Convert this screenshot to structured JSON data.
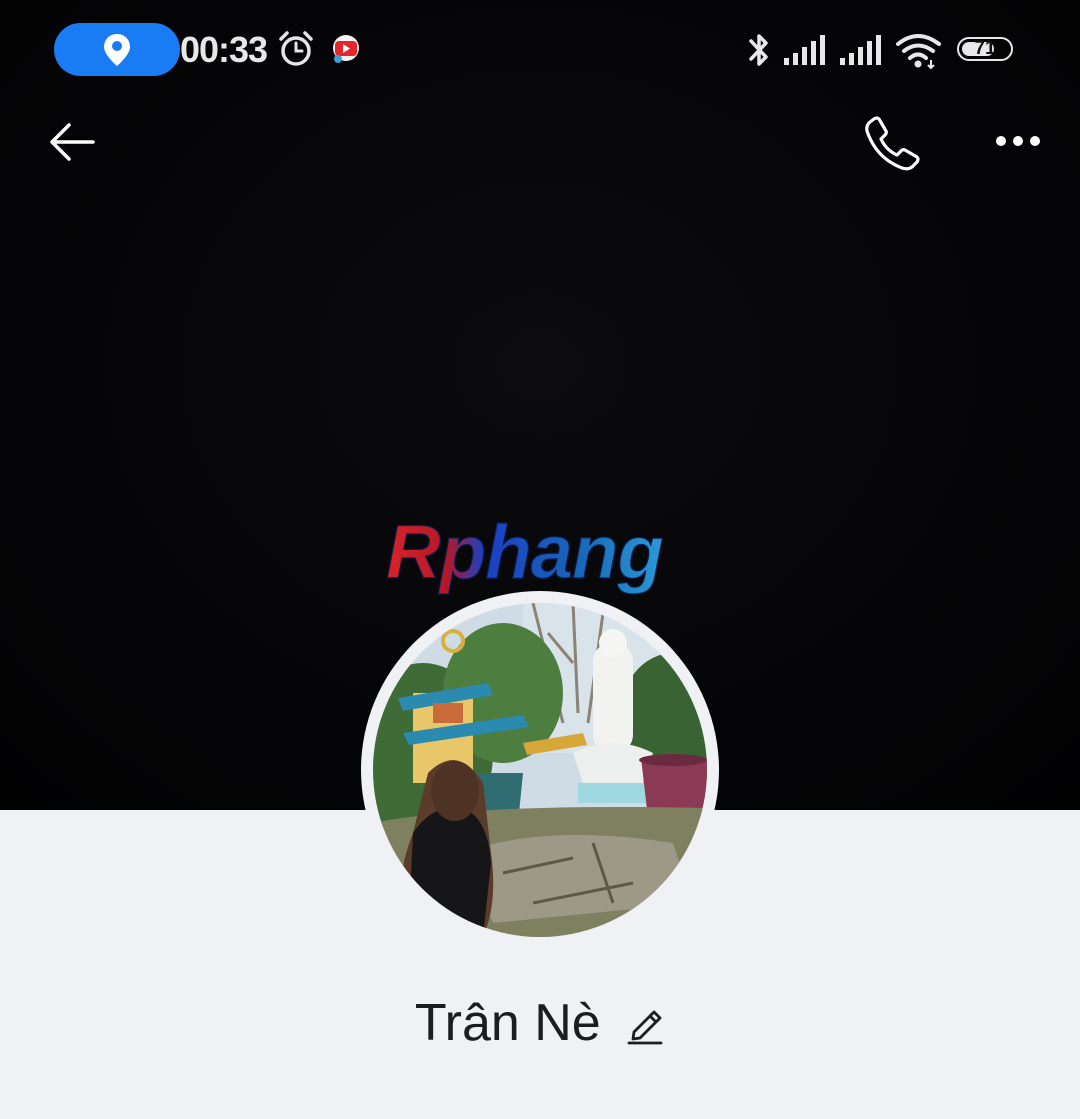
{
  "status_bar": {
    "time": "00:33",
    "battery_level": "71",
    "battery_fraction": 0.71,
    "icons": [
      "location-icon",
      "alarm-icon",
      "youtube-notification-icon",
      "bluetooth-icon",
      "signal-icon",
      "signal-icon",
      "wifi-icon",
      "battery-icon"
    ]
  },
  "header": {
    "back_icon": "arrow-left-icon",
    "call_icon": "phone-icon",
    "more_icon": "more-horizontal-icon"
  },
  "watermark": {
    "text": "Rphang"
  },
  "profile": {
    "name": "Trân Nè",
    "edit_icon": "pencil-icon"
  },
  "colors": {
    "accent": "#1a7cf5",
    "cover_background": "#050507",
    "page_background": "#eff1f5",
    "text": "#1d1d1f",
    "icon": "#ffffff"
  }
}
